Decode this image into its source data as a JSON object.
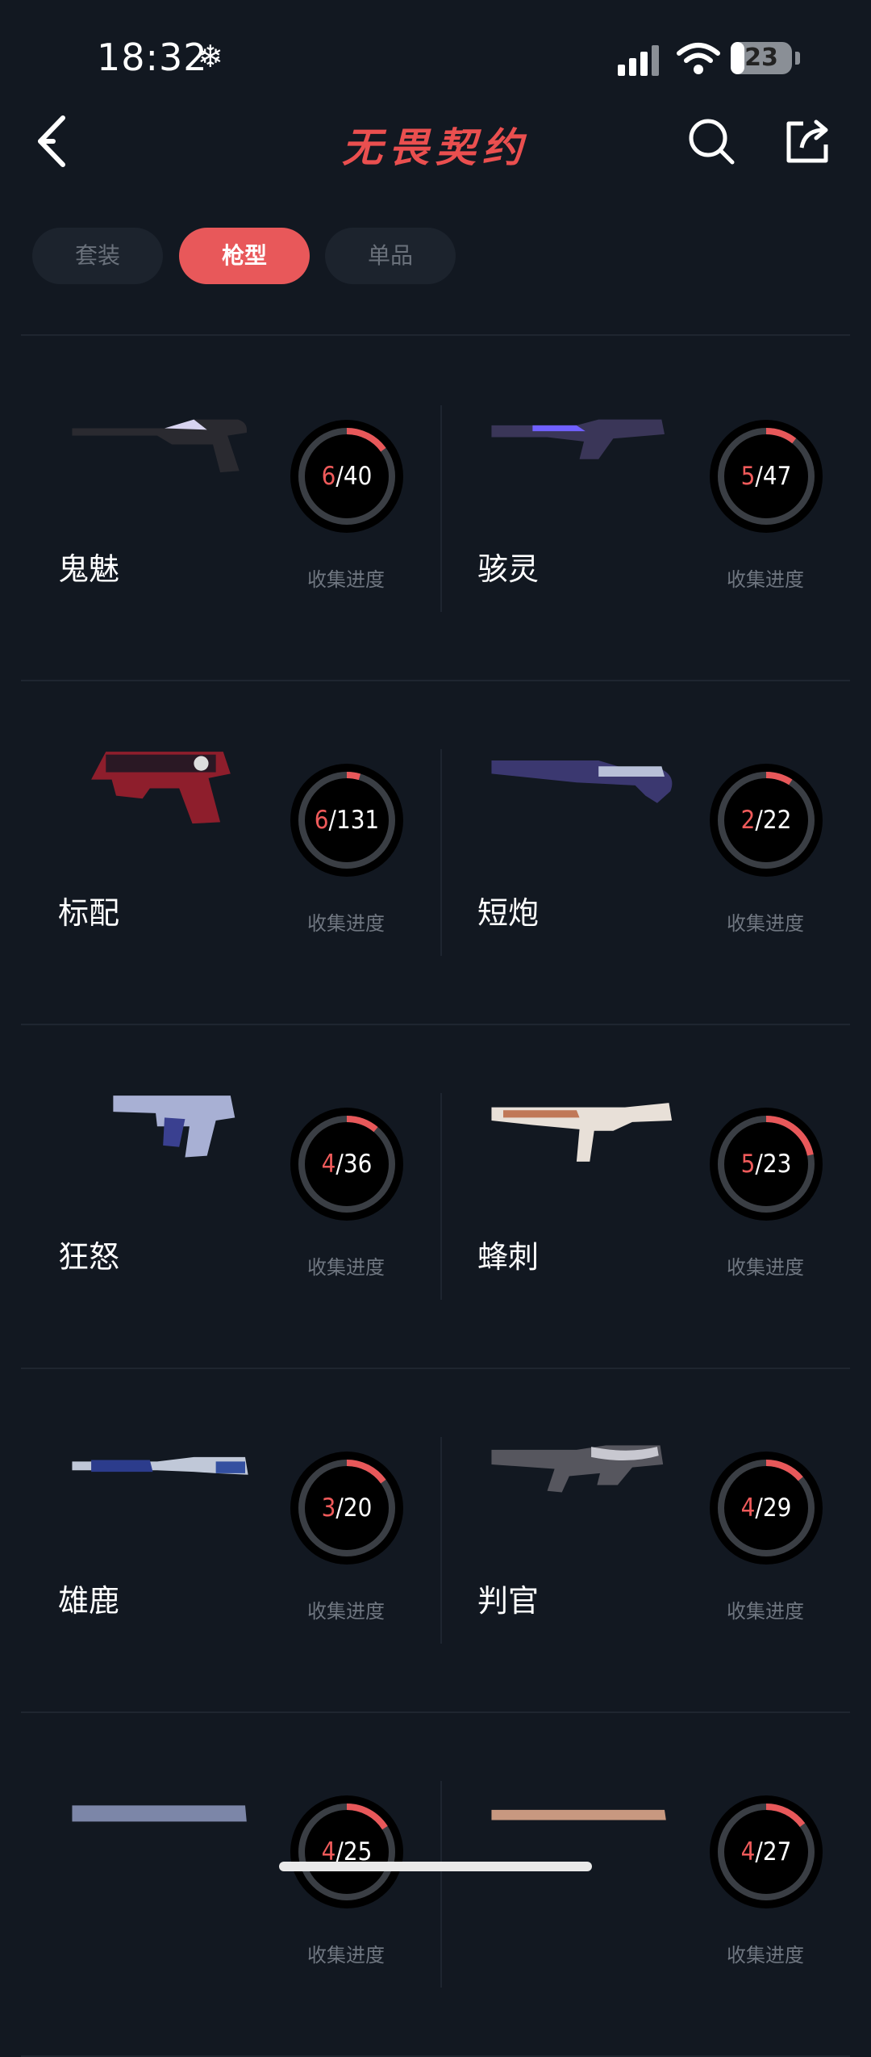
{
  "status_bar": {
    "time": "18:32",
    "battery": "23",
    "battery_level": 0.23
  },
  "header": {
    "brand": "无畏契约",
    "icons": [
      "back-icon",
      "search-icon",
      "share-icon"
    ]
  },
  "tabs": [
    {
      "label": "套装",
      "active": false
    },
    {
      "label": "枪型",
      "active": true
    },
    {
      "label": "单品",
      "active": false
    }
  ],
  "progress_label": "收集进度",
  "weapons": [
    {
      "name": "鬼魅",
      "collected": 6,
      "total": 40
    },
    {
      "name": "骇灵",
      "collected": 5,
      "total": 47
    },
    {
      "name": "标配",
      "collected": 6,
      "total": 131
    },
    {
      "name": "短炮",
      "collected": 2,
      "total": 22
    },
    {
      "name": "狂怒",
      "collected": 4,
      "total": 36
    },
    {
      "name": "蜂刺",
      "collected": 5,
      "total": 23
    },
    {
      "name": "雄鹿",
      "collected": 3,
      "total": 20
    },
    {
      "name": "判官",
      "collected": 4,
      "total": 29
    },
    {
      "name": "",
      "collected": 4,
      "total": 25
    },
    {
      "name": "",
      "collected": 4,
      "total": 27
    }
  ],
  "colors": {
    "accent": "#e8585a",
    "background": "#121821"
  }
}
